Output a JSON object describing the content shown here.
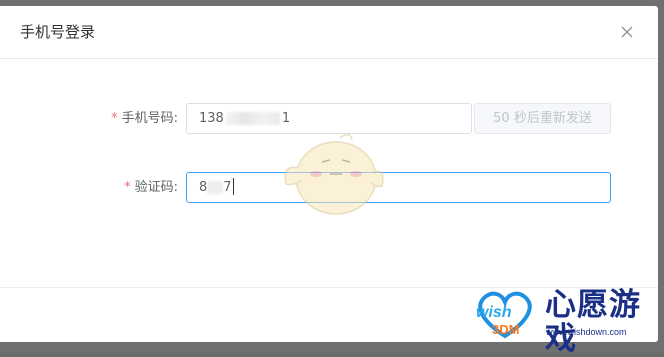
{
  "dialog": {
    "title": "手机号登录",
    "close_icon": "close-icon"
  },
  "form": {
    "phone": {
      "required_mark": "*",
      "label": "手机号码:",
      "value_prefix": "138",
      "value_suffix": "1"
    },
    "resend_button": {
      "label": "50 秒后重新发送"
    },
    "code": {
      "required_mark": "*",
      "label": "验证码:",
      "value_prefix": "8",
      "value_suffix": "7"
    }
  },
  "watermark": {
    "brand": "心愿游戏",
    "url": "www.wishdown.com",
    "wish": "wish",
    "brand_small": "3DM"
  },
  "colors": {
    "required": "#f56c6c",
    "focus_border": "#409eff",
    "disabled_text": "#c0c4cc"
  }
}
